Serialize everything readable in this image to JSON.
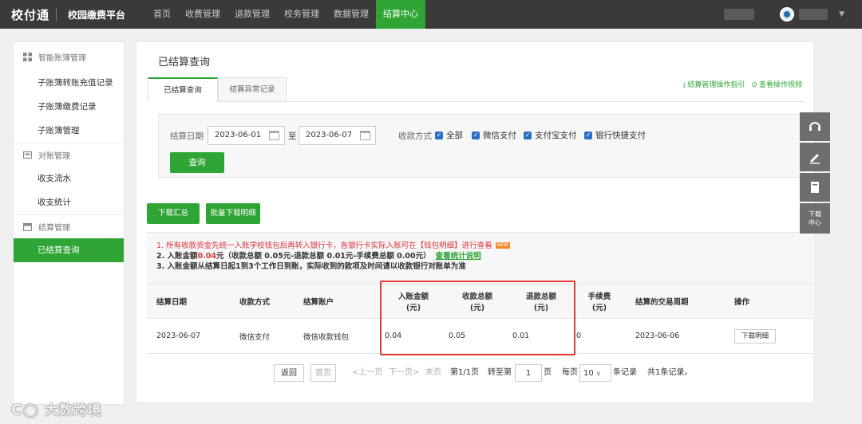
{
  "topbar": {
    "logo": "校付通",
    "platform": "校园缴费平台",
    "nav": [
      "首页",
      "收费管理",
      "退款管理",
      "校务管理",
      "数据管理",
      "结算中心"
    ],
    "active_nav": 5
  },
  "sidebar": {
    "groups": [
      {
        "label": "智能账簿管理",
        "icon": "grid-icon",
        "items": [
          "子账簿转账充值记录",
          "子账簿缴费记录",
          "子账簿管理"
        ]
      },
      {
        "label": "对账管理",
        "icon": "ledger-icon",
        "items": [
          "收支流水",
          "收支统计"
        ]
      },
      {
        "label": "结算管理",
        "icon": "calendar-icon",
        "items": [
          "已结算查询"
        ]
      }
    ]
  },
  "main": {
    "title": "已结算查询",
    "tabs": [
      "已结算查询",
      "结算异常记录"
    ],
    "links": [
      "结算管理操作指引",
      "查看操作视频"
    ],
    "filter": {
      "date_label": "结算日期",
      "start_date": "2023-06-01",
      "date_sep": "至",
      "end_date": "2023-06-07",
      "pay_label": "收款方式",
      "options": [
        "全部",
        "微信支付",
        "支付宝支付",
        "银行快捷支付"
      ],
      "query_label": "查询"
    },
    "buttons": {
      "download_summary": "下载汇总",
      "batch_download": "批量下载明细"
    },
    "notice": {
      "line1": "1. 所有收款资金先统一入账学校钱包后再转入银行卡，各银行卡实际入账可在【钱包明细】进行查看",
      "new_badge": "NEW",
      "line2_prefix": "2. 入账金额",
      "line2_amount": "0.04",
      "line2_rest": "元（收款总额 0.05元-退款总额 0.01元-手续费总额 0.00元）",
      "line2_link": "查看统计说明",
      "line3": "3. 入账金额从结算日起1到3个工作日到账，实际收到的款项及时间请以收款银行对账单为准"
    },
    "table": {
      "headers": [
        "结算日期",
        "收款方式",
        "结算账户",
        "入账金额\n(元)",
        "收款总额\n(元)",
        "退款总额\n(元)",
        "手续费\n(元)",
        "结算的交易周期",
        "操作"
      ],
      "rows": [
        [
          "2023-06-07",
          "微信支付",
          "微信收款钱包",
          "0.04",
          "0.05",
          "0.01",
          "0",
          "2023-06-06",
          "下载明细"
        ]
      ]
    },
    "pager": {
      "back": "返回",
      "first": "首页",
      "prev": "<上一页",
      "next": "下一页>",
      "last": "末页",
      "page_info": "第1/1页",
      "goto_prefix": "转至第",
      "goto_value": "1",
      "goto_suffix": "页",
      "per_page_prefix": "每页",
      "per_page_value": "10",
      "per_page_suffix": "条记录",
      "total": "共1条记录。"
    }
  },
  "float_tools": [
    "headset-icon",
    "edit-icon",
    "document-icon"
  ],
  "float_download": "下载中心",
  "watermark": "大数跨境",
  "colors": {
    "accent": "#2ea535",
    "topbar": "#3a3a3a",
    "highlight": "#e53935"
  }
}
